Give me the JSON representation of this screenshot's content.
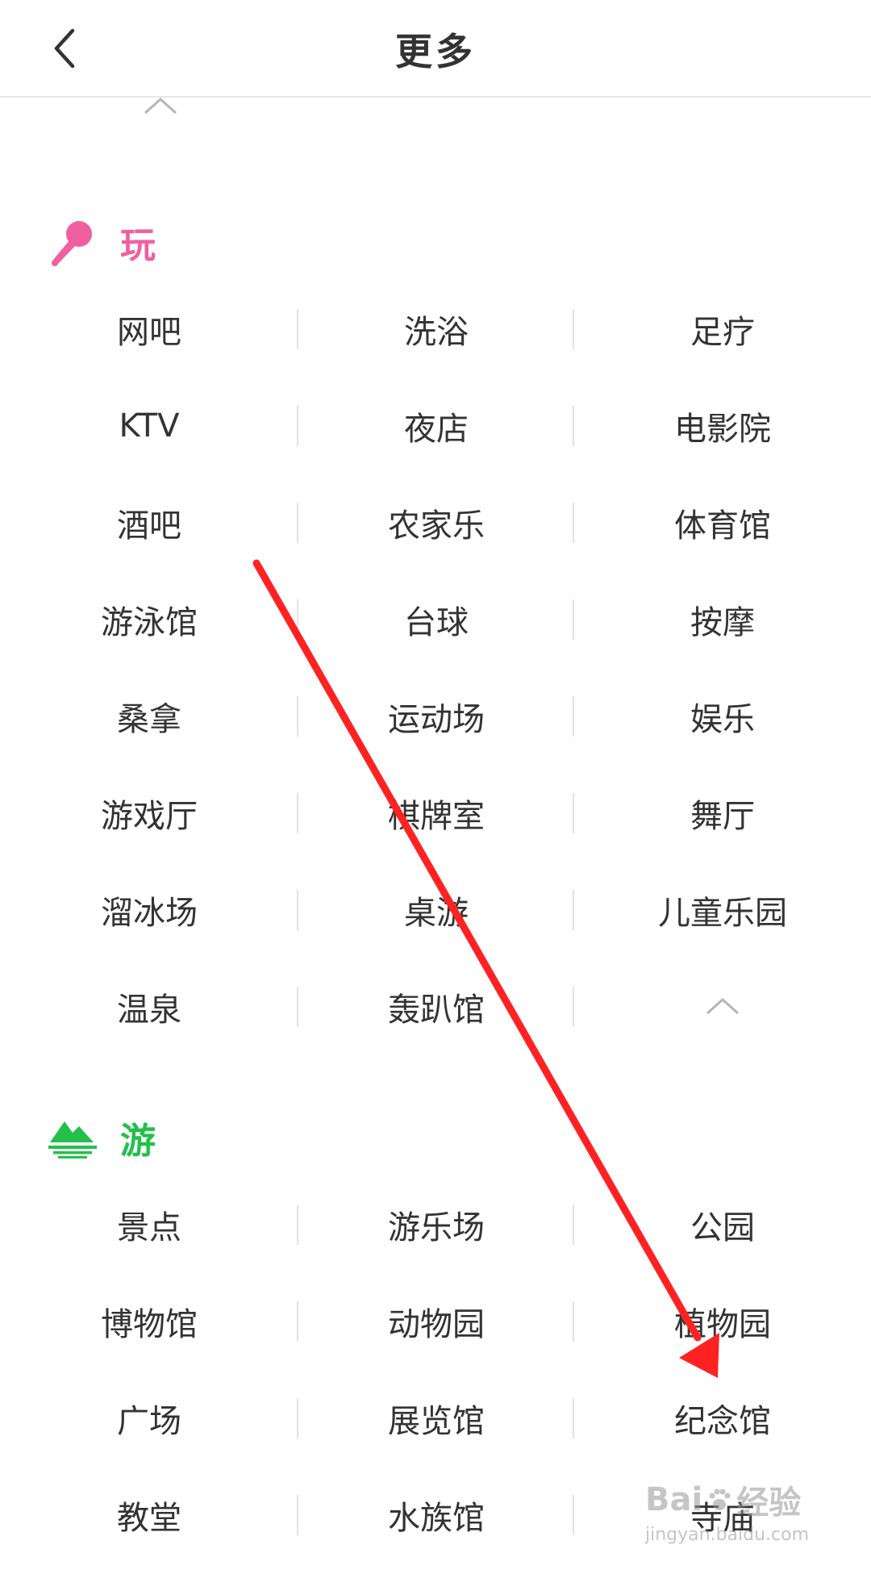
{
  "header": {
    "title": "更多"
  },
  "sections": {
    "play": {
      "title": "玩",
      "color": "#f0609e",
      "icon": "microphone-icon",
      "items": [
        "网吧",
        "洗浴",
        "足疗",
        "KTV",
        "夜店",
        "电影院",
        "酒吧",
        "农家乐",
        "体育馆",
        "游泳馆",
        "台球",
        "按摩",
        "桑拿",
        "运动场",
        "娱乐",
        "游戏厅",
        "棋牌室",
        "舞厅",
        "溜冰场",
        "桌游",
        "儿童乐园",
        "温泉",
        "轰趴馆"
      ]
    },
    "travel": {
      "title": "游",
      "color": "#22c04a",
      "icon": "mountain-icon",
      "items": [
        "景点",
        "游乐场",
        "公园",
        "博物馆",
        "动物园",
        "植物园",
        "广场",
        "展览馆",
        "纪念馆",
        "教堂",
        "水族馆",
        "寺庙"
      ]
    }
  },
  "annotation": {
    "color": "#ff2222",
    "type": "arrow"
  },
  "watermark": {
    "brand": "Bai",
    "name": "经验",
    "url": "jingyan.baidu.com"
  }
}
